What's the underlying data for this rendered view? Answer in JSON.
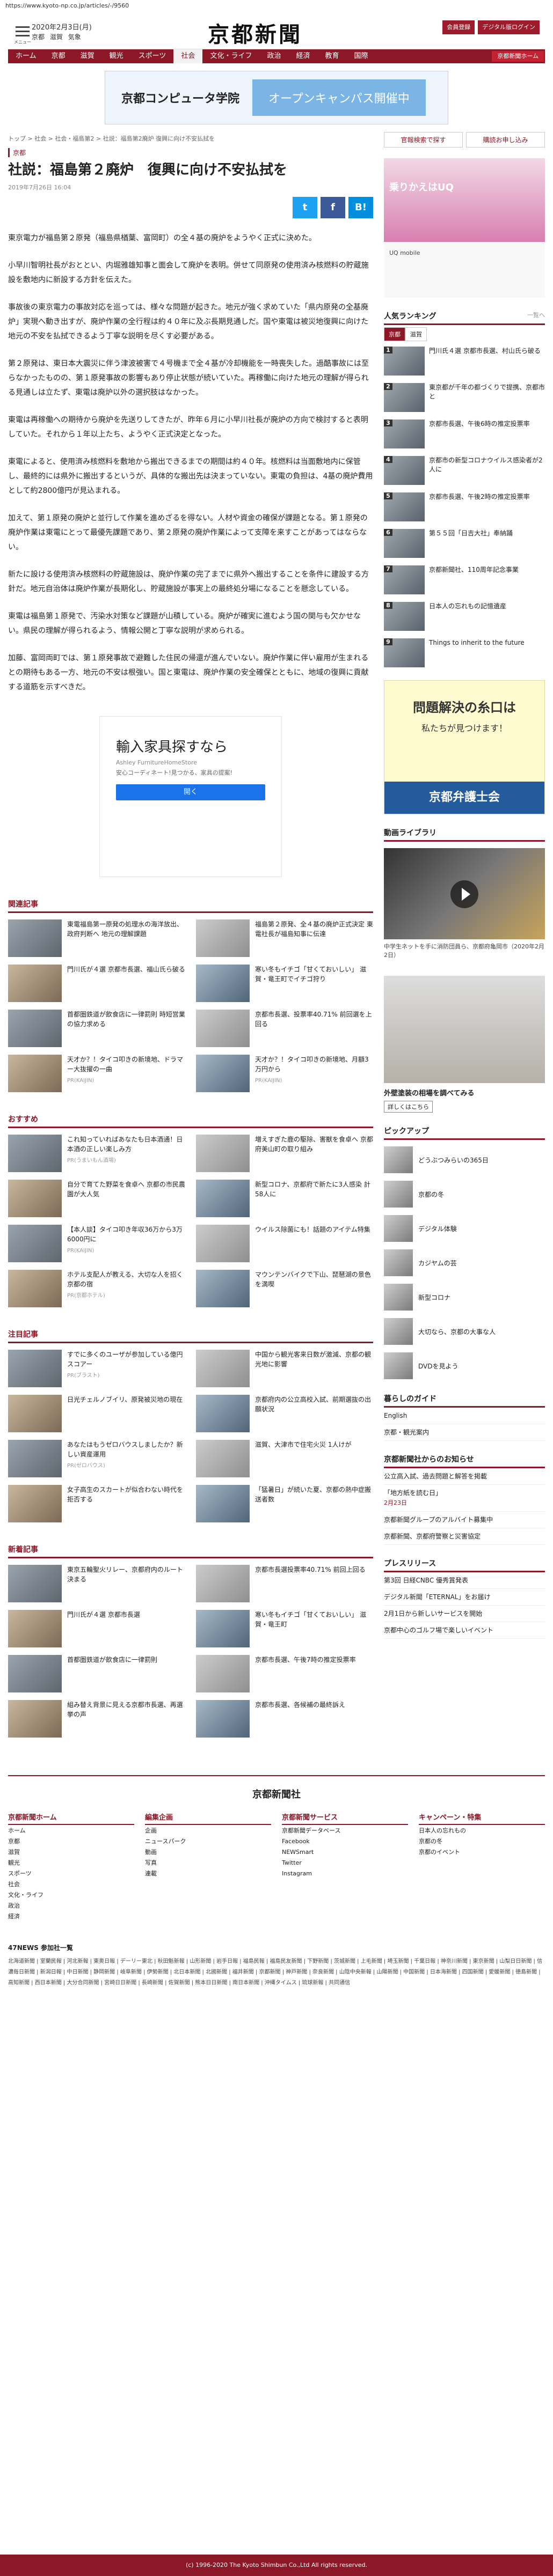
{
  "url": "https://www.kyoto-np.co.jp/articles/-/9560",
  "header": {
    "menu_label": "メニュー",
    "date": "2020年2月3日(月)",
    "cities": [
      "京都",
      "滋賀",
      "気象"
    ],
    "logo": "京都新聞",
    "buttons": [
      "会員登録",
      "デジタル版ログイン"
    ]
  },
  "nav": {
    "items": [
      "ホーム",
      "京都",
      "滋賀",
      "観光",
      "スポーツ",
      "社会",
      "文化・ライフ",
      "政治",
      "経済",
      "教育",
      "国際"
    ],
    "active": "社会",
    "extra": "京都新聞ホーム"
  },
  "banner": {
    "name": "京都コンピュータ学院",
    "cta": "オープンキャンパス開催中"
  },
  "article": {
    "breadcrumb": "トップ > 社会 > 社会・福島第2 > 社説：福島第2廃炉 復興に向け不安払拭を",
    "category": "京都",
    "title": "社説：福島第２廃炉　復興に向け不安払拭を",
    "date": "2019年7月26日 16:04",
    "share": [
      "t",
      "f",
      "B!"
    ],
    "paragraphs": [
      "東京電力が福島第２原発（福島県楢葉、富岡町）の全４基の廃炉をようやく正式に決めた。",
      "小早川智明社長がおととい、内堀雅雄知事と面会して廃炉を表明。併せて同原発の使用済み核燃料の貯蔵施設を敷地内に新設する方針を伝えた。",
      "事故後の東京電力の事故対応を巡っては、様々な問題が起きた。地元が強く求めていた「県内原発の全基廃炉」実現へ動き出すが、廃炉作業の全行程は約４０年に及ぶ長期見通しだ。国や東電は被災地復興に向けた地元の不安を払拭できるよう丁寧な説明を尽くす必要がある。",
      "第２原発は、東日本大震災に伴う津波被害で４号機まで全４基が冷却機能を一時喪失した。過酷事故には至らなかったものの、第１原発事故の影響もあり停止状態が続いていた。再稼働に向けた地元の理解が得られる見通しは立たず、東電は廃炉以外の選択肢はなかった。",
      "東電は再稼働への期待から廃炉を先送りしてきたが、昨年６月に小早川社長が廃炉の方向で検討すると表明していた。それから１年以上たち、ようやく正式決定となった。",
      "東電によると、使用済み核燃料を敷地から搬出できるまでの期間は約４０年。核燃料は当面敷地内に保管し、最終的には県外に搬出するというが、具体的な搬出先は決まっていない。東電の負担は、4基の廃炉費用として約2800億円が見込まれる。",
      "加えて、第１原発の廃炉と並行して作業を進めざるを得ない。人材や資金の確保が課題となる。第１原発の廃炉作業は東電にとって最優先課題であり、第２原発の廃炉作業によって支障を来すことがあってはならない。",
      "新たに設ける使用済み核燃料の貯蔵施設は、廃炉作業の完了までに県外へ搬出することを条件に建設する方針だ。地元自治体は廃炉作業が長期化し、貯蔵施設が事実上の最終処分場になることを懸念している。",
      "東電は福島第１原発で、汚染水対策など課題が山積している。廃炉が確実に進むよう国の関与も欠かせない。県民の理解が得られるよう、情報公開と丁寧な説明が求められる。",
      "加藤、富岡両町では、第１原発事故で避難した住民の帰還が進んでいない。廃炉作業に伴い雇用が生まれるとの期待もある一方、地元の不安は根強い。国と東電は、廃炉作業の安全確保とともに、地域の復興に貢献する道筋を示すべきだ。"
    ]
  },
  "ad_box": {
    "title": "輸入家具探すなら",
    "sub": "Ashley FurnitureHomeStore",
    "desc": "安心コーディネート!見つかる、家具の提案!",
    "button": "開く"
  },
  "related": {
    "heading": "関連記事",
    "items": [
      {
        "text": "東電福島第一原発の処理水の海洋放出、政府判断へ 地元の理解課題",
        "src": ""
      },
      {
        "text": "福島第２原発、全４基の廃炉正式決定 東電社長が福島知事に伝達",
        "src": ""
      },
      {
        "text": "門川氏が４選 京都市長選、福山氏ら破る",
        "src": ""
      },
      {
        "text": "寒い冬もイチゴ「甘くておいしい」 滋賀・竜王町でイチゴ狩り",
        "src": ""
      },
      {
        "text": "首都圏鉄道が飲食店に一律罰則 時短営業の協力求める",
        "src": ""
      },
      {
        "text": "京都市長選、投票率40.71% 前回選を上回る",
        "src": ""
      },
      {
        "text": "天才か？！タイコ叩きの新境地、ドラマー大抜擢の一曲",
        "src": "PR(KAIJIN)"
      },
      {
        "text": "天才か？！タイコ叩きの新境地、月額3万円から",
        "src": "PR(KAIJIN)"
      }
    ]
  },
  "osusume": {
    "heading": "おすすめ",
    "items": [
      {
        "text": "これ知っていればあなたも日本酒通！日本酒の正しい楽しみ方",
        "src": "PR(うまいもん酒場)"
      },
      {
        "text": "増えすぎた鹿の駆除、害獣を食卓へ 京都府美山町の取り組み",
        "src": ""
      },
      {
        "text": "自分で育てた野菜を食卓へ 京都の市民農園が大人気",
        "src": ""
      },
      {
        "text": "新型コロナ、京都府で新たに3人感染 計58人に",
        "src": ""
      },
      {
        "text": "【本人談】タイコ叩き年収36万から3万6000円に",
        "src": "PR(KAIJIN)"
      },
      {
        "text": "ウイルス除菌にも！話題のアイテム特集",
        "src": ""
      },
      {
        "text": "ホテル支配人が教える、大切な人を招く京都の宿",
        "src": "PR(京都ホテル)"
      },
      {
        "text": "マウンテンバイクで下山、琵琶湖の景色を満喫",
        "src": ""
      }
    ]
  },
  "chumoku": {
    "heading": "注目記事",
    "items": [
      {
        "text": "すでに多くのユーザが参加している億円スコアー",
        "src": "PR(ブラスト)"
      },
      {
        "text": "中国から観光客来日数が激減、京都の観光地に影響",
        "src": ""
      },
      {
        "text": "日光チェルノブイリ、原発被災地の現在",
        "src": ""
      },
      {
        "text": "京都府内の公立高校入試、前期選抜の出願状況",
        "src": ""
      },
      {
        "text": "あなたはもうゼロバウスしましたか？新しい資産運用",
        "src": "PR(ゼロバウス)"
      },
      {
        "text": "滋賀、大津市で住宅火災 1人けが",
        "src": ""
      },
      {
        "text": "女子高生のスカートが似合わない時代を拒否する",
        "src": ""
      },
      {
        "text": "「猛暑日」が続いた夏、京都の熱中症搬送者数",
        "src": ""
      }
    ]
  },
  "shinchaku": {
    "heading": "新着記事",
    "items": [
      {
        "text": "東京五輪聖火リレー、京都府内のルート決まる",
        "src": ""
      },
      {
        "text": "京都市長選投票率40.71% 前回上回る",
        "src": ""
      },
      {
        "text": "門川氏が４選 京都市長選",
        "src": ""
      },
      {
        "text": "寒い冬もイチゴ「甘くておいしい」 滋賀・竜王町",
        "src": ""
      },
      {
        "text": "首都圏鉄道が飲食店に一律罰則",
        "src": ""
      },
      {
        "text": "京都市長選、午後7時の推定投票率",
        "src": ""
      },
      {
        "text": "組み替え背景に見える京都市長選、再選挙の声",
        "src": ""
      },
      {
        "text": "京都市長選、各候補の最終訴え",
        "src": ""
      }
    ]
  },
  "side": {
    "top_links": [
      "官報検索で探す",
      "購読お申し込み"
    ],
    "ad_title": "乗りかえはUQ",
    "ad_text": "UQ mobile",
    "ranking_heading": "人気ランキング",
    "ranking_more": "一覧へ",
    "ranking_tabs": [
      "京都",
      "滋賀"
    ],
    "ranking": [
      "門川氏４選 京都市長選、村山氏ら破る",
      "東京都が千年の都づくりで提携、京都市と",
      "京都市長選、午後6時の推定投票率",
      "京都市の新型コロナウイルス感染者が2人に",
      "京都市長選、午後2時の推定投票率",
      "第５５回「日吉大社」奉納踊",
      "京都新聞社、110周年記念事業",
      "日本人の忘れもの記憶遺産",
      "Things to inherit to the future"
    ],
    "ad2_a": "問題解決の糸口は",
    "ad2_b": "私たちが見つけます！",
    "ad2_c": "京都弁護士会",
    "video_heading": "動画ライブラリ",
    "video_caption": "中学生ネットを手に消防団員ら、京都府亀岡市（2020年2月2日）",
    "ad3_caption": "外壁塗装の相場を調べてみる",
    "ad3_btn": "詳しくはこちら",
    "pickup_heading": "ピックアップ",
    "pickups": [
      "どうぶつみらいの365日",
      "京都の冬",
      "デジタル体験",
      "カジヤムの芸",
      "新型コロナ",
      "大切なら、京都の大事な人",
      "DVDを見よう"
    ],
    "life_heading": "暮らしのガイド",
    "life_items": [
      "English",
      "京都・観光案内"
    ],
    "info_heading": "京都新聞社からのお知らせ",
    "info_items": [
      {
        "t": "公立高入試、過去問題と解答を掲載",
        "d": ""
      },
      {
        "t": "「地方紙を読む日」",
        "d": "2月23日"
      },
      {
        "t": "京都新聞グループのアルバイト募集中",
        "d": ""
      },
      {
        "t": "京都新聞、京都府警察と災害協定",
        "d": ""
      }
    ],
    "press_heading": "プレスリリース",
    "press_items": [
      {
        "t": "第3回 日経CNBC 優秀賞発表",
        "d": ""
      },
      {
        "t": "デジタル新聞「ETERNAL」をお届け",
        "d": ""
      },
      {
        "t": "2月1日から新しいサービスを開始",
        "d": ""
      },
      {
        "t": "京都中心のゴルフ場で楽しいイベント",
        "d": ""
      }
    ]
  },
  "footer": {
    "logo": "京都新聞社",
    "cols": [
      {
        "h": "京都新聞ホーム",
        "items": [
          "ホーム",
          "京都",
          "滋賀",
          "観光",
          "スポーツ",
          "社会",
          "文化・ライフ",
          "政治",
          "経済"
        ]
      },
      {
        "h": "編集企画",
        "items": [
          "企画",
          "ニュースパーク",
          "動画",
          "写真",
          "連載"
        ]
      },
      {
        "h": "京都新聞サービス",
        "items": [
          "京都新聞データベース",
          "Facebook",
          "NEWSmart",
          "Twitter",
          "Instagram"
        ]
      },
      {
        "h": "キャンペーン・特集",
        "items": [
          "日本人の忘れもの",
          "京都の冬",
          "京都のイベント"
        ]
      }
    ],
    "news_heading": "47NEWS 参加社一覧",
    "news_line": "北海道新聞 | 室蘭民報 | 河北新報 | 東奥日報 | デーリー東北 | 秋田魁新報 | 山形新聞 | 岩手日報 | 福島民報 | 福島民友新聞 | 下野新聞 | 茨城新聞 | 上毛新聞 | 埼玉新聞 | 千葉日報 | 神奈川新聞 | 東京新聞 | 山梨日日新聞 | 信濃毎日新聞 | 新潟日報 | 中日新聞 | 静岡新聞 | 岐阜新聞 | 伊勢新聞 | 北日本新聞 | 北國新聞 | 福井新聞 | 京都新聞 | 神戸新聞 | 奈良新聞 | 山陰中央新報 | 山陽新聞 | 中国新聞 | 日本海新聞 | 四国新聞 | 愛媛新聞 | 徳島新聞 | 高知新聞 | 西日本新聞 | 大分合同新聞 | 宮崎日日新聞 | 長崎新聞 | 佐賀新聞 | 熊本日日新聞 | 南日本新聞 | 沖縄タイムス | 琉球新報 | 共同通信",
    "copyright": "(c) 1996-2020 The Kyoto Shimbun Co.,Ltd All rights reserved."
  }
}
